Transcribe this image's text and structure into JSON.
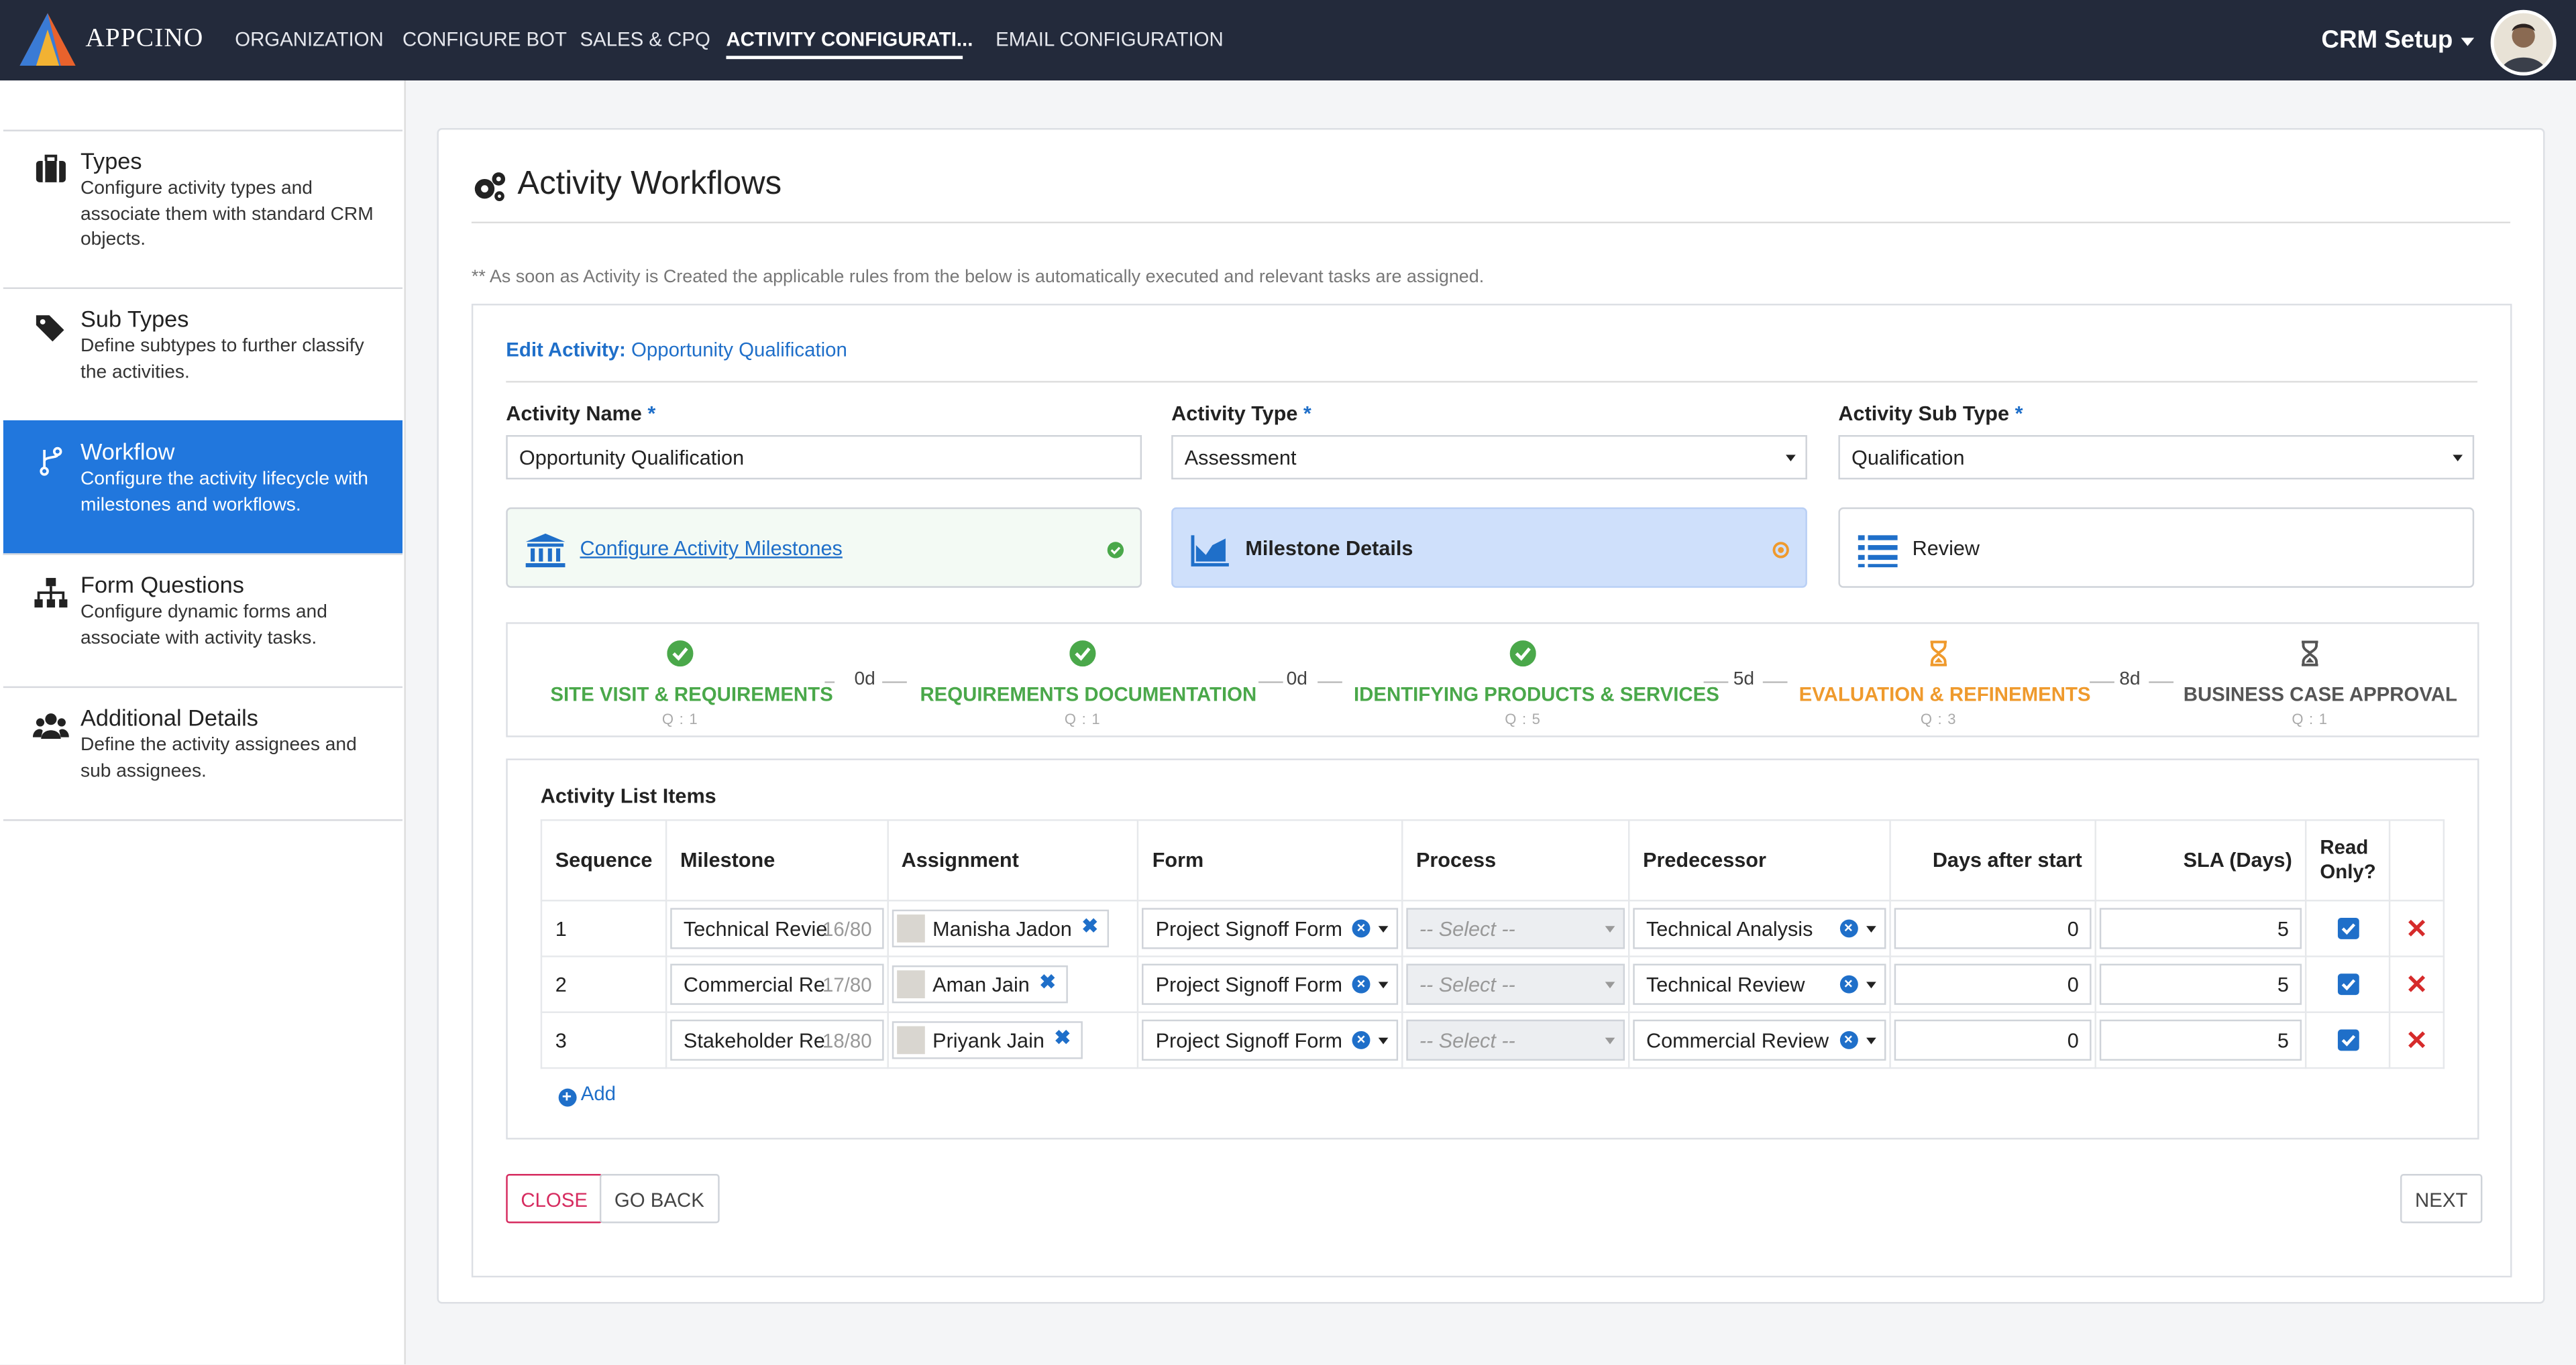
{
  "app": {
    "name": "APPCINO",
    "setup_label": "CRM Setup"
  },
  "nav": {
    "items": [
      "ORGANIZATION",
      "CONFIGURE BOT",
      "SALES & CPQ",
      "ACTIVITY CONFIGURATI...",
      "EMAIL CONFIGURATION"
    ],
    "active_index": 3
  },
  "sidebar": {
    "items": [
      {
        "title": "Types",
        "desc": "Configure activity types and associate them with standard CRM objects.",
        "icon": "briefcase-icon"
      },
      {
        "title": "Sub Types",
        "desc": "Define subtypes to further classify the activities.",
        "icon": "tags-icon"
      },
      {
        "title": "Workflow",
        "desc": "Configure the activity lifecycle with milestones and workflows.",
        "icon": "branch-icon",
        "active": true
      },
      {
        "title": "Form Questions",
        "desc": "Configure dynamic forms and associate with activity tasks.",
        "icon": "sitemap-icon"
      },
      {
        "title": "Additional Details",
        "desc": "Define the activity assignees and sub assignees.",
        "icon": "users-icon"
      }
    ]
  },
  "page": {
    "title": "Activity Workflows",
    "note": "** As soon as Activity is Created the applicable rules from the below is automatically executed and relevant tasks are assigned."
  },
  "edit": {
    "label": "Edit Activity:",
    "name": "Opportunity Qualification"
  },
  "fields": {
    "activity_name": {
      "label": "Activity Name",
      "value": "Opportunity Qualification"
    },
    "activity_type": {
      "label": "Activity Type",
      "value": "Assessment"
    },
    "activity_sub_type": {
      "label": "Activity Sub Type",
      "value": "Qualification"
    },
    "required_mark": "*"
  },
  "steps": [
    {
      "label": "Configure Activity Milestones",
      "state": "done"
    },
    {
      "label": "Milestone  Details",
      "state": "current"
    },
    {
      "label": "Review",
      "state": "pending"
    }
  ],
  "milestones": [
    {
      "name": "SITE VISIT & REQUIREMENTS",
      "q": "Q : 1",
      "status": "done"
    },
    {
      "name": "REQUIREMENTS DOCUMENTATION",
      "q": "Q : 1",
      "status": "done"
    },
    {
      "name": "IDENTIFYING PRODUCTS & SERVICES",
      "q": "Q : 5",
      "status": "done"
    },
    {
      "name": "EVALUATION & REFINEMENTS",
      "q": "Q : 3",
      "status": "in-progress"
    },
    {
      "name": "BUSINESS CASE APPROVAL",
      "q": "Q : 1",
      "status": "pending"
    }
  ],
  "milestone_gaps": [
    "0d",
    "0d",
    "5d",
    "8d"
  ],
  "list": {
    "title": "Activity List Items",
    "columns": [
      "Sequence",
      "Milestone",
      "Assignment",
      "Form",
      "Process",
      "Predecessor",
      "Days after start",
      "SLA (Days)",
      "Read Only?"
    ],
    "process_placeholder": "-- Select --",
    "rows": [
      {
        "sequence": "1",
        "milestone": "Technical Revie",
        "counter": "16/80",
        "assignee": "Manisha Jadon",
        "form": "Project Signoff Form",
        "predecessor": "Technical Analysis",
        "days_after_start": "0",
        "sla": "5",
        "read_only": true
      },
      {
        "sequence": "2",
        "milestone": "Commercial Re",
        "counter": "17/80",
        "assignee": "Aman Jain",
        "form": "Project Signoff Form",
        "predecessor": "Technical Review",
        "days_after_start": "0",
        "sla": "5",
        "read_only": true
      },
      {
        "sequence": "3",
        "milestone": "Stakeholder Re",
        "counter": "18/80",
        "assignee": "Priyank Jain",
        "form": "Project Signoff Form",
        "predecessor": "Commercial Review",
        "days_after_start": "0",
        "sla": "5",
        "read_only": true
      }
    ],
    "add_label": "Add"
  },
  "buttons": {
    "close": "CLOSE",
    "go_back": "GO BACK",
    "next": "NEXT"
  },
  "colors": {
    "nav_bg": "#232a3b",
    "accent": "#2177dd",
    "done": "#4aa84a",
    "in_progress": "#ef9a2d",
    "danger": "#d62b2b"
  }
}
